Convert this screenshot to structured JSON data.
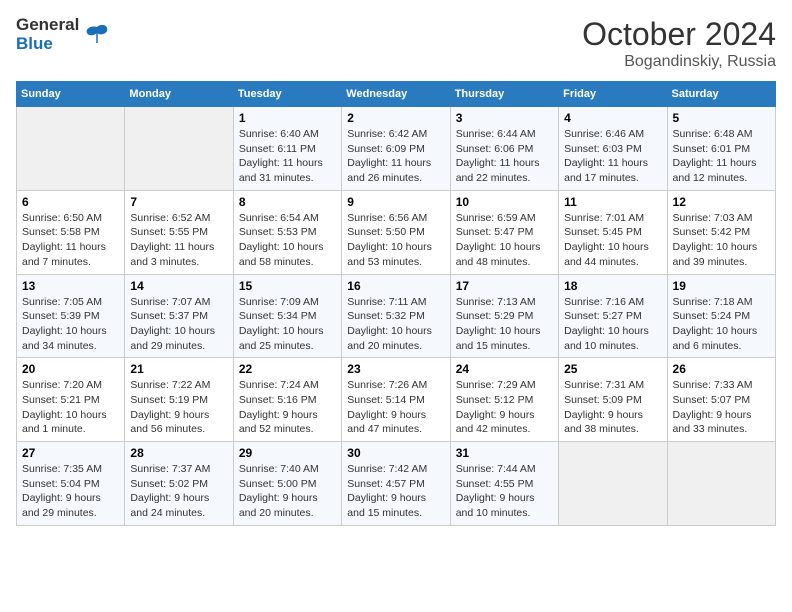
{
  "header": {
    "logo_line1": "General",
    "logo_line2": "Blue",
    "title": "October 2024",
    "subtitle": "Bogandinskiy, Russia"
  },
  "weekdays": [
    "Sunday",
    "Monday",
    "Tuesday",
    "Wednesday",
    "Thursday",
    "Friday",
    "Saturday"
  ],
  "weeks": [
    [
      {
        "day": "",
        "info": ""
      },
      {
        "day": "",
        "info": ""
      },
      {
        "day": "1",
        "info": "Sunrise: 6:40 AM\nSunset: 6:11 PM\nDaylight: 11 hours and 31 minutes."
      },
      {
        "day": "2",
        "info": "Sunrise: 6:42 AM\nSunset: 6:09 PM\nDaylight: 11 hours and 26 minutes."
      },
      {
        "day": "3",
        "info": "Sunrise: 6:44 AM\nSunset: 6:06 PM\nDaylight: 11 hours and 22 minutes."
      },
      {
        "day": "4",
        "info": "Sunrise: 6:46 AM\nSunset: 6:03 PM\nDaylight: 11 hours and 17 minutes."
      },
      {
        "day": "5",
        "info": "Sunrise: 6:48 AM\nSunset: 6:01 PM\nDaylight: 11 hours and 12 minutes."
      }
    ],
    [
      {
        "day": "6",
        "info": "Sunrise: 6:50 AM\nSunset: 5:58 PM\nDaylight: 11 hours and 7 minutes."
      },
      {
        "day": "7",
        "info": "Sunrise: 6:52 AM\nSunset: 5:55 PM\nDaylight: 11 hours and 3 minutes."
      },
      {
        "day": "8",
        "info": "Sunrise: 6:54 AM\nSunset: 5:53 PM\nDaylight: 10 hours and 58 minutes."
      },
      {
        "day": "9",
        "info": "Sunrise: 6:56 AM\nSunset: 5:50 PM\nDaylight: 10 hours and 53 minutes."
      },
      {
        "day": "10",
        "info": "Sunrise: 6:59 AM\nSunset: 5:47 PM\nDaylight: 10 hours and 48 minutes."
      },
      {
        "day": "11",
        "info": "Sunrise: 7:01 AM\nSunset: 5:45 PM\nDaylight: 10 hours and 44 minutes."
      },
      {
        "day": "12",
        "info": "Sunrise: 7:03 AM\nSunset: 5:42 PM\nDaylight: 10 hours and 39 minutes."
      }
    ],
    [
      {
        "day": "13",
        "info": "Sunrise: 7:05 AM\nSunset: 5:39 PM\nDaylight: 10 hours and 34 minutes."
      },
      {
        "day": "14",
        "info": "Sunrise: 7:07 AM\nSunset: 5:37 PM\nDaylight: 10 hours and 29 minutes."
      },
      {
        "day": "15",
        "info": "Sunrise: 7:09 AM\nSunset: 5:34 PM\nDaylight: 10 hours and 25 minutes."
      },
      {
        "day": "16",
        "info": "Sunrise: 7:11 AM\nSunset: 5:32 PM\nDaylight: 10 hours and 20 minutes."
      },
      {
        "day": "17",
        "info": "Sunrise: 7:13 AM\nSunset: 5:29 PM\nDaylight: 10 hours and 15 minutes."
      },
      {
        "day": "18",
        "info": "Sunrise: 7:16 AM\nSunset: 5:27 PM\nDaylight: 10 hours and 10 minutes."
      },
      {
        "day": "19",
        "info": "Sunrise: 7:18 AM\nSunset: 5:24 PM\nDaylight: 10 hours and 6 minutes."
      }
    ],
    [
      {
        "day": "20",
        "info": "Sunrise: 7:20 AM\nSunset: 5:21 PM\nDaylight: 10 hours and 1 minute."
      },
      {
        "day": "21",
        "info": "Sunrise: 7:22 AM\nSunset: 5:19 PM\nDaylight: 9 hours and 56 minutes."
      },
      {
        "day": "22",
        "info": "Sunrise: 7:24 AM\nSunset: 5:16 PM\nDaylight: 9 hours and 52 minutes."
      },
      {
        "day": "23",
        "info": "Sunrise: 7:26 AM\nSunset: 5:14 PM\nDaylight: 9 hours and 47 minutes."
      },
      {
        "day": "24",
        "info": "Sunrise: 7:29 AM\nSunset: 5:12 PM\nDaylight: 9 hours and 42 minutes."
      },
      {
        "day": "25",
        "info": "Sunrise: 7:31 AM\nSunset: 5:09 PM\nDaylight: 9 hours and 38 minutes."
      },
      {
        "day": "26",
        "info": "Sunrise: 7:33 AM\nSunset: 5:07 PM\nDaylight: 9 hours and 33 minutes."
      }
    ],
    [
      {
        "day": "27",
        "info": "Sunrise: 7:35 AM\nSunset: 5:04 PM\nDaylight: 9 hours and 29 minutes."
      },
      {
        "day": "28",
        "info": "Sunrise: 7:37 AM\nSunset: 5:02 PM\nDaylight: 9 hours and 24 minutes."
      },
      {
        "day": "29",
        "info": "Sunrise: 7:40 AM\nSunset: 5:00 PM\nDaylight: 9 hours and 20 minutes."
      },
      {
        "day": "30",
        "info": "Sunrise: 7:42 AM\nSunset: 4:57 PM\nDaylight: 9 hours and 15 minutes."
      },
      {
        "day": "31",
        "info": "Sunrise: 7:44 AM\nSunset: 4:55 PM\nDaylight: 9 hours and 10 minutes."
      },
      {
        "day": "",
        "info": ""
      },
      {
        "day": "",
        "info": ""
      }
    ]
  ]
}
